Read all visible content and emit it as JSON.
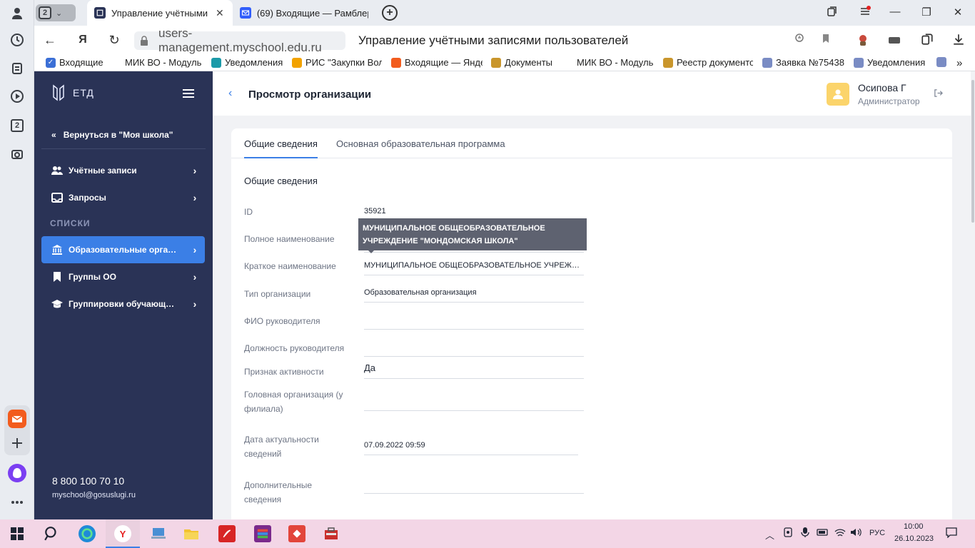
{
  "browser": {
    "tab_count": "2",
    "tabs": [
      {
        "title": "Управление учётными",
        "active": true
      },
      {
        "title": "(69) Входящие — Рамблер",
        "active": false
      }
    ],
    "url": "users-management.myschool.edu.ru",
    "page_title": "Управление учётными записями пользователей",
    "side_badge": "2",
    "bookmarks": [
      "Входящие",
      "МИК ВО - Модуль",
      "Уведомления",
      "РИС \"Закупки Вол",
      "Входящие — Янде",
      "Документы",
      "МИК ВО - Модуль",
      "Реестр документо",
      "Заявка №75438",
      "Уведомления"
    ],
    "more_bookmarks": "»"
  },
  "app": {
    "logo_text": "ЕТД",
    "back_link": "Вернуться в \"Моя школа\"",
    "menu": [
      {
        "label": "Учётные записи",
        "active": false
      },
      {
        "label": "Запросы",
        "active": false
      }
    ],
    "section_label": "СПИСКИ",
    "lists": [
      {
        "label": "Образовательные организации",
        "active": true
      },
      {
        "label": "Группы ОО",
        "active": false
      },
      {
        "label": "Группировки обучающихся",
        "active": false
      }
    ],
    "phone": "8 800 100 70 10",
    "email": "myschool@gosuslugi.ru"
  },
  "header": {
    "title": "Просмотр организации",
    "user_name": "Осипова Г",
    "user_role": "Администратор"
  },
  "tabs": [
    "Общие сведения",
    "Основная образовательная программа"
  ],
  "section_title": "Общие сведения",
  "fields": [
    {
      "label": "ID",
      "value": "35921"
    },
    {
      "label": "Полное наименование",
      "value": ""
    },
    {
      "label": "Краткое наименование",
      "value": "МУНИЦИПАЛЬНОЕ ОБЩЕОБРАЗОВАТЕЛЬНОЕ УЧРЕЖДЕНИЕ \"МОНДОМСКАЯ ШКОЛА\""
    },
    {
      "label": "Тип организации",
      "value": "Образовательная организация"
    },
    {
      "label": "ФИО руководителя",
      "value": ""
    },
    {
      "label": "Должность руководителя",
      "value": ""
    },
    {
      "label": "Признак активности",
      "value": "Да"
    },
    {
      "label": "Головная организация (у филиала)",
      "value": ""
    },
    {
      "label": "Дата актуальности сведений",
      "value": "07.09.2022 09:59"
    },
    {
      "label": "Дополнительные сведения",
      "value": ""
    }
  ],
  "tooltip": "МУНИЦИПАЛЬНОЕ ОБЩЕОБРАЗОВАТЕЛЬНОЕ УЧРЕЖДЕНИЕ \"МОНДОМСКАЯ ШКОЛА\"",
  "taskbar": {
    "lang": "РУС",
    "time": "10:00",
    "date": "26.10.2023"
  },
  "colors": {
    "sidebar": "#2a3356",
    "accent": "#3b7fe6",
    "taskbar": "#f3d6e6"
  }
}
